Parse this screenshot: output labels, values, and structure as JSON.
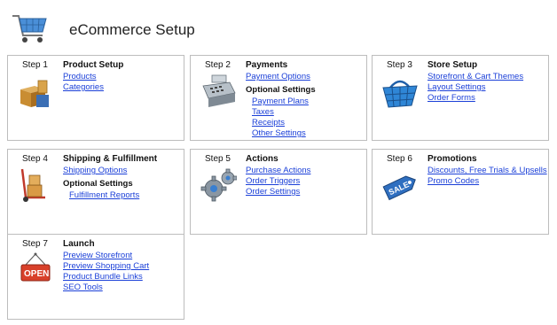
{
  "header": {
    "title": "eCommerce Setup",
    "icon": "shopping-cart-icon"
  },
  "steps": [
    {
      "step": "Step 1",
      "title": "Product Setup",
      "icon": "boxes-icon",
      "links": [
        "Products",
        "Categories"
      ]
    },
    {
      "step": "Step 2",
      "title": "Payments",
      "icon": "cash-register-icon",
      "links": [
        "Payment Options"
      ],
      "optional_label": "Optional Settings",
      "optional_links": [
        "Payment Plans",
        "Taxes",
        "Receipts",
        "Other Settings"
      ]
    },
    {
      "step": "Step 3",
      "title": "Store Setup",
      "icon": "shopping-basket-icon",
      "links": [
        "Storefront & Cart Themes",
        "Layout Settings",
        "Order Forms"
      ]
    },
    {
      "step": "Step 4",
      "title": "Shipping & Fulfillment",
      "icon": "hand-truck-icon",
      "links": [
        "Shipping Options"
      ],
      "optional_label": "Optional Settings",
      "optional_links": [
        "Fulfillment Reports"
      ]
    },
    {
      "step": "Step 5",
      "title": "Actions",
      "icon": "gears-icon",
      "links": [
        "Purchase Actions",
        "Order Triggers",
        "Order Settings"
      ]
    },
    {
      "step": "Step 6",
      "title": "Promotions",
      "icon": "sale-tag-icon",
      "icon_text": "SALE",
      "links": [
        "Discounts, Free Trials & Upsells",
        "Promo Codes"
      ]
    },
    {
      "step": "Step 7",
      "title": "Launch",
      "icon": "open-sign-icon",
      "icon_text": "OPEN",
      "links": [
        "Preview Storefront",
        "Preview Shopping Cart",
        "Product Bundle Links",
        "SEO Tools"
      ]
    }
  ],
  "colors": {
    "link": "#1a3fd8",
    "border": "#bdbdbd",
    "accent_blue": "#2f7fd0",
    "open_sign_red": "#d8402a"
  }
}
